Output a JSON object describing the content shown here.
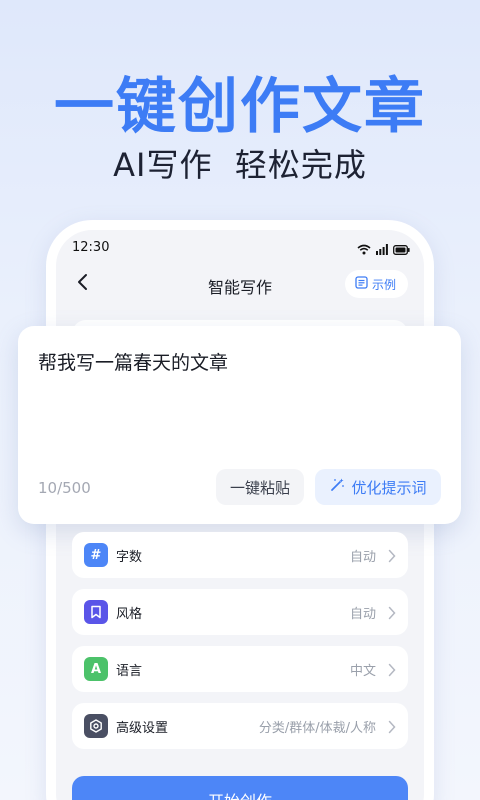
{
  "hero": {
    "title": "一键创作文章",
    "subtitle": "AI写作  轻松完成"
  },
  "status_bar": {
    "time": "12:30",
    "icons": [
      "wifi-icon",
      "signal-icon",
      "battery-icon"
    ]
  },
  "nav": {
    "title": "智能写作",
    "back_icon": "chevron-left-icon",
    "example_label": "示例",
    "example_icon": "document-icon"
  },
  "prompt": {
    "text": "帮我写一篇春天的文章",
    "count": "10/500",
    "paste_label": "一键粘贴",
    "optimize_label": "优化提示词",
    "optimize_icon": "magic-wand-icon"
  },
  "settings": [
    {
      "label": "字数",
      "value": "自动",
      "icon": "hash-icon",
      "icon_glyph": "#",
      "color": "#4d86f7"
    },
    {
      "label": "风格",
      "value": "自动",
      "icon": "bookmark-icon",
      "icon_glyph": "",
      "color": "#5a55e8"
    },
    {
      "label": "语言",
      "value": "中文",
      "icon": "language-icon",
      "icon_glyph": "A",
      "color": "#4cc26a"
    },
    {
      "label": "高级设置",
      "value": "分类/群体/体裁/人称",
      "icon": "gear-icon",
      "icon_glyph": "",
      "color": "#4a4f63"
    }
  ],
  "start_button": {
    "label": "开始创作"
  },
  "colors": {
    "accent": "#3d7cf5",
    "button": "#4d86f7"
  }
}
